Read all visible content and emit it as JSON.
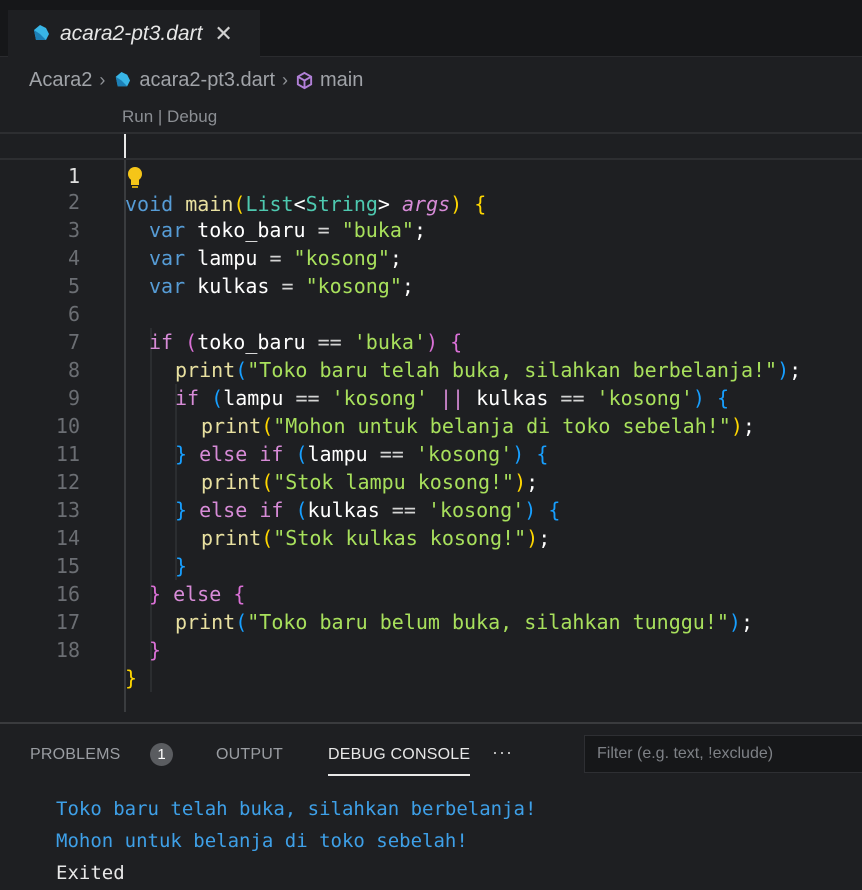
{
  "tab": {
    "filename": "acara2-pt3.dart",
    "close_glyph": "✕"
  },
  "breadcrumb": {
    "folder": "Acara2",
    "file": "acara2-pt3.dart",
    "symbol": "main",
    "separator": "›"
  },
  "editor": {
    "codelens": "Run | Debug",
    "active_line": 1,
    "lines": [
      {
        "n": "1"
      },
      {
        "n": "2"
      },
      {
        "n": "3"
      },
      {
        "n": "4"
      },
      {
        "n": "5"
      },
      {
        "n": "6"
      },
      {
        "n": "7"
      },
      {
        "n": "8"
      },
      {
        "n": "9"
      },
      {
        "n": "10"
      },
      {
        "n": "11"
      },
      {
        "n": "12"
      },
      {
        "n": "13"
      },
      {
        "n": "14"
      },
      {
        "n": "15"
      },
      {
        "n": "16"
      },
      {
        "n": "17"
      },
      {
        "n": "18"
      }
    ],
    "code": {
      "l1": {
        "void": "void",
        "main": "main",
        "List": "List",
        "String": "String",
        "args": "args"
      },
      "l2": {
        "var": "var",
        "name": "toko_baru",
        "value": "\"buka\""
      },
      "l3": {
        "var": "var",
        "name": "lampu",
        "value": "\"kosong\""
      },
      "l4": {
        "var": "var",
        "name": "kulkas",
        "value": "\"kosong\""
      },
      "l6": {
        "if": "if",
        "name": "toko_baru",
        "value": "'buka'"
      },
      "l7": {
        "fn": "print",
        "value": "\"Toko baru telah buka, silahkan berbelanja!\""
      },
      "l8": {
        "if": "if",
        "a": "lampu",
        "av": "'kosong'",
        "b": "kulkas",
        "bv": "'kosong'"
      },
      "l9": {
        "fn": "print",
        "value": "\"Mohon untuk belanja di toko sebelah!\""
      },
      "l10": {
        "else": "else",
        "if": "if",
        "name": "lampu",
        "value": "'kosong'"
      },
      "l11": {
        "fn": "print",
        "value": "\"Stok lampu kosong!\""
      },
      "l12": {
        "else": "else",
        "if": "if",
        "name": "kulkas",
        "value": "'kosong'"
      },
      "l13": {
        "fn": "print",
        "value": "\"Stok kulkas kosong!\""
      },
      "l15": {
        "else": "else"
      },
      "l16": {
        "fn": "print",
        "value": "\"Toko baru belum buka, silahkan tunggu!\""
      }
    }
  },
  "panel": {
    "tabs": {
      "problems": "PROBLEMS",
      "problems_count": "1",
      "output": "OUTPUT",
      "debug_console": "DEBUG CONSOLE",
      "more": "···"
    },
    "filter_placeholder": "Filter (e.g. text, !exclude)",
    "console": [
      "Toko baru telah buka, silahkan berbelanja!",
      "Mohon untuk belanja di toko sebelah!",
      "Exited"
    ]
  },
  "colors": {
    "accent_keyword": "#569cd6",
    "string": "#a8e05c",
    "console_output": "#3ea0e8"
  }
}
